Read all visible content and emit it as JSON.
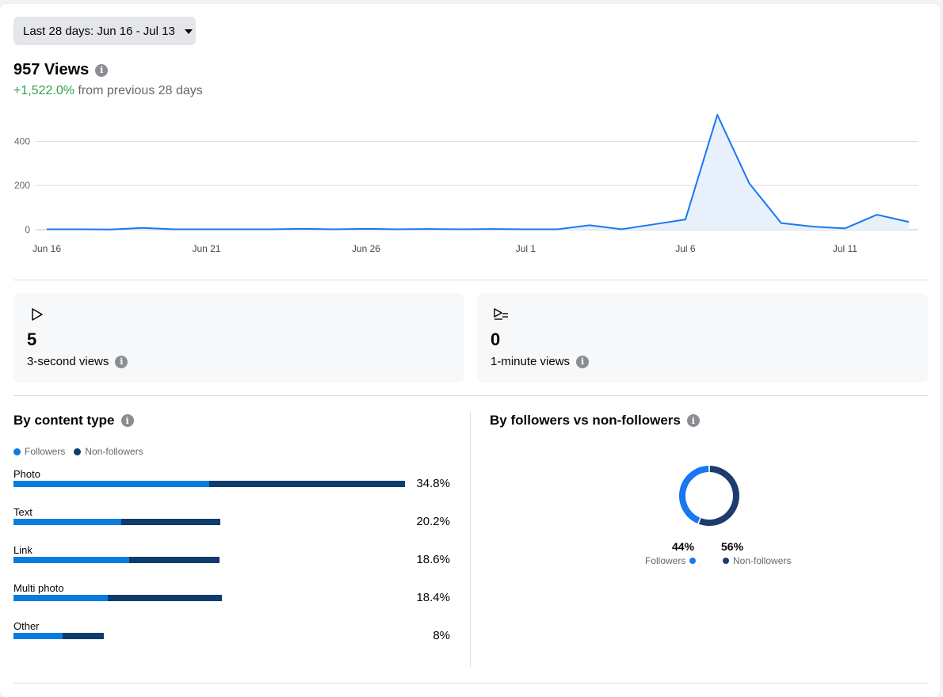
{
  "date_range": {
    "label": "Last 28 days: Jun 16 - Jul 13"
  },
  "summary": {
    "views_title": "957 Views",
    "delta_value": "+1,522.0%",
    "delta_text": " from previous 28 days"
  },
  "chart_data": {
    "type": "area",
    "x": [
      "Jun 16",
      "Jun 17",
      "Jun 18",
      "Jun 19",
      "Jun 20",
      "Jun 21",
      "Jun 22",
      "Jun 23",
      "Jun 24",
      "Jun 25",
      "Jun 26",
      "Jun 27",
      "Jun 28",
      "Jun 29",
      "Jun 30",
      "Jul 1",
      "Jul 2",
      "Jul 3",
      "Jul 4",
      "Jul 5",
      "Jul 6",
      "Jul 7",
      "Jul 8",
      "Jul 9",
      "Jul 10",
      "Jul 11",
      "Jul 12",
      "Jul 13"
    ],
    "values": [
      2,
      2,
      1,
      8,
      2,
      2,
      2,
      2,
      4,
      2,
      4,
      2,
      3,
      2,
      3,
      2,
      2,
      20,
      2,
      24,
      46,
      520,
      210,
      30,
      14,
      6,
      68,
      35
    ],
    "xticks": [
      "Jun 16",
      "Jun 21",
      "Jun 26",
      "Jul 1",
      "Jul 6",
      "Jul 11"
    ],
    "yticks": [
      0,
      200,
      400
    ],
    "ylim": [
      0,
      520
    ],
    "grid": true,
    "color": "#1877f2",
    "fill": "#e7f0fb"
  },
  "stats": [
    {
      "icon": "play-icon",
      "value": "5",
      "label": "3-second views"
    },
    {
      "icon": "play-list-icon",
      "value": "0",
      "label": "1-minute views"
    }
  ],
  "content_type": {
    "title": "By content type",
    "legend": {
      "followers": "Followers",
      "non_followers": "Non-followers"
    },
    "colors": {
      "followers": "#0a7ce0",
      "non_followers": "#0d3c6e"
    },
    "rows": [
      {
        "name": "Photo",
        "pct": "34.8%",
        "followers": 34.8,
        "non_followers": 34.8
      },
      {
        "name": "Text",
        "pct": "20.2%",
        "followers": 19.1,
        "non_followers": 17.7
      },
      {
        "name": "Link",
        "pct": "18.6%",
        "followers": 20.5,
        "non_followers": 16.1
      },
      {
        "name": "Multi photo",
        "pct": "18.4%",
        "followers": 16.8,
        "non_followers": 20.2
      },
      {
        "name": "Other",
        "pct": "8%",
        "followers": 8.8,
        "non_followers": 7.2
      }
    ]
  },
  "followers_split": {
    "title": "By followers vs non-followers",
    "followers_pct": "44%",
    "non_followers_pct": "56%",
    "followers_label": "Followers",
    "non_followers_label": "Non-followers",
    "followers_value": 44,
    "non_followers_value": 56,
    "colors": {
      "followers": "#1877f2",
      "non_followers": "#1c3b6e"
    }
  }
}
